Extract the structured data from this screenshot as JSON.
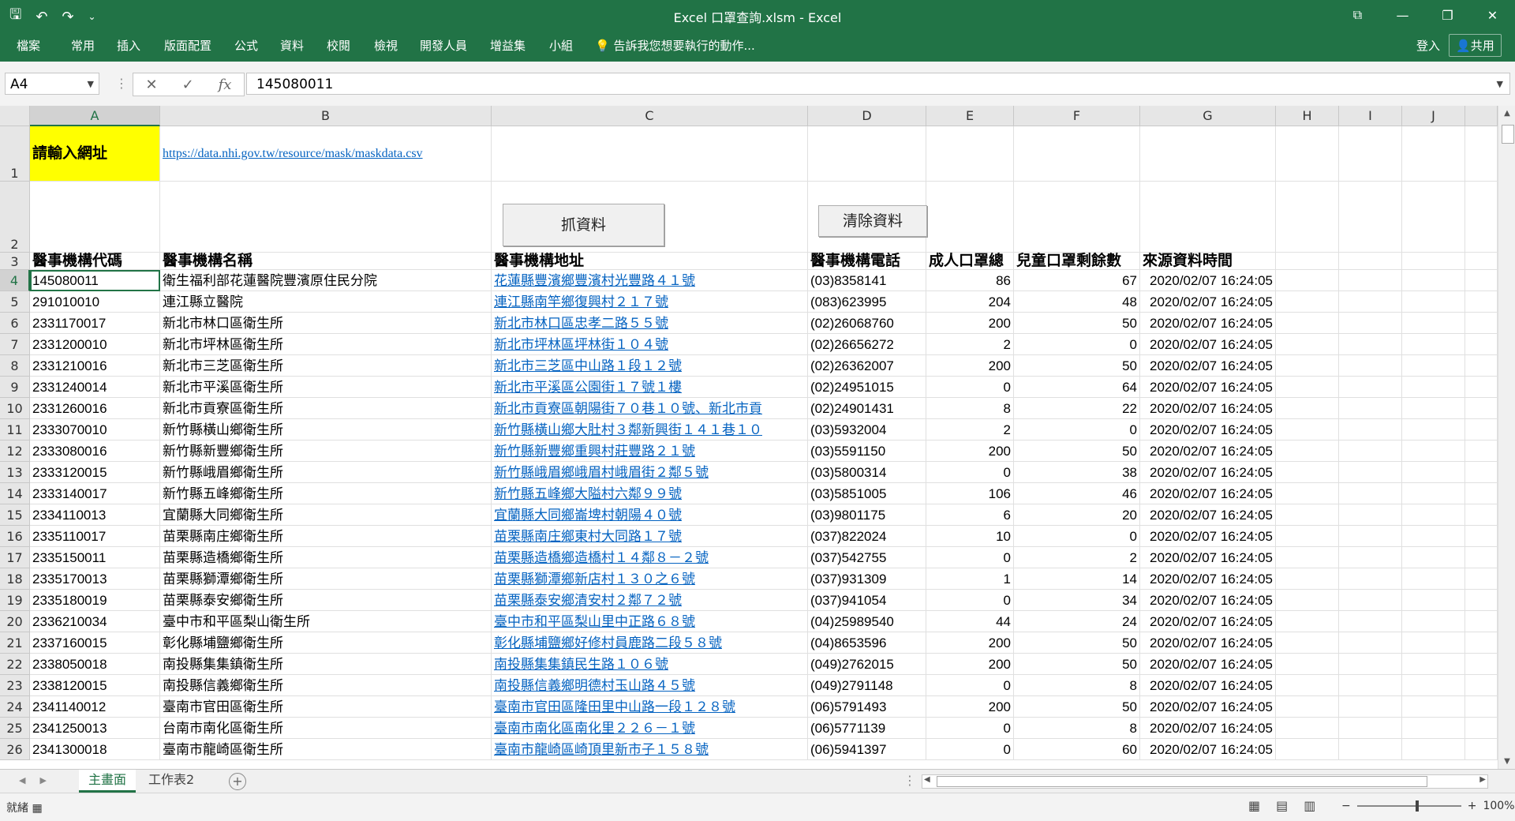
{
  "window": {
    "title": "Excel 口罩查詢.xlsm - Excel",
    "controls": [
      "⧉",
      "—",
      "❐",
      "✕"
    ]
  },
  "qat": {
    "save": "🖫",
    "undo": "↶",
    "redo": "↷",
    "more": "⌄"
  },
  "ribbon": {
    "tabs": [
      "檔案",
      "常用",
      "插入",
      "版面配置",
      "公式",
      "資料",
      "校閱",
      "檢視",
      "開發人員",
      "增益集",
      "小組"
    ],
    "tell_me": "告訴我您想要執行的動作...",
    "sign_in": "登入",
    "share": "共用"
  },
  "formula_bar": {
    "name_box": "A4",
    "cancel": "✕",
    "enter": "✓",
    "fx": "fx",
    "value": "145080011"
  },
  "columns": [
    "A",
    "B",
    "C",
    "D",
    "E",
    "F",
    "G",
    "H",
    "I",
    "J"
  ],
  "row1": {
    "label": "請輸入網址",
    "url": "https://data.nhi.gov.tw/resource/mask/maskdata.csv"
  },
  "buttons": {
    "fetch": "抓資料",
    "clear": "清除資料"
  },
  "headers": [
    "醫事機構代碼",
    "醫事機構名稱",
    "醫事機構地址",
    "醫事機構電話",
    "成人口罩總",
    "兒童口罩剩餘數",
    "來源資料時間"
  ],
  "rows": [
    {
      "code": "145080011",
      "name": "衛生福利部花蓮醫院豐濱原住民分院",
      "addr": "花蓮縣豐濱鄉豐濱村光豐路４１號",
      "tel": "(03)8358141",
      "adult": "86",
      "child": "67",
      "time": "2020/02/07 16:24:05"
    },
    {
      "code": "291010010",
      "name": "連江縣立醫院",
      "addr": "連江縣南竿鄉復興村２１７號",
      "tel": "(083)623995",
      "adult": "204",
      "child": "48",
      "time": "2020/02/07 16:24:05"
    },
    {
      "code": "2331170017",
      "name": "新北市林口區衛生所",
      "addr": "新北市林口區忠孝二路５５號",
      "tel": "(02)26068760",
      "adult": "200",
      "child": "50",
      "time": "2020/02/07 16:24:05"
    },
    {
      "code": "2331200010",
      "name": "新北市坪林區衛生所",
      "addr": "新北市坪林區坪林街１０４號",
      "tel": "(02)26656272",
      "adult": "2",
      "child": "0",
      "time": "2020/02/07 16:24:05"
    },
    {
      "code": "2331210016",
      "name": "新北市三芝區衛生所",
      "addr": "新北市三芝區中山路１段１２號",
      "tel": "(02)26362007",
      "adult": "200",
      "child": "50",
      "time": "2020/02/07 16:24:05"
    },
    {
      "code": "2331240014",
      "name": "新北市平溪區衛生所",
      "addr": "新北市平溪區公園街１７號１樓",
      "tel": "(02)24951015",
      "adult": "0",
      "child": "64",
      "time": "2020/02/07 16:24:05"
    },
    {
      "code": "2331260016",
      "name": "新北市貢寮區衛生所",
      "addr": "新北市貢寮區朝陽街７０巷１０號、新北市貢",
      "tel": "(02)24901431",
      "adult": "8",
      "child": "22",
      "time": "2020/02/07 16:24:05"
    },
    {
      "code": "2333070010",
      "name": "新竹縣橫山鄉衛生所",
      "addr": "新竹縣橫山鄉大肚村３鄰新興街１４１巷１０",
      "tel": "(03)5932004",
      "adult": "2",
      "child": "0",
      "time": "2020/02/07 16:24:05"
    },
    {
      "code": "2333080016",
      "name": "新竹縣新豐鄉衛生所",
      "addr": "新竹縣新豐鄉重興村莊豐路２１號",
      "tel": "(03)5591150",
      "adult": "200",
      "child": "50",
      "time": "2020/02/07 16:24:05"
    },
    {
      "code": "2333120015",
      "name": "新竹縣峨眉鄉衛生所",
      "addr": "新竹縣峨眉鄉峨眉村峨眉街２鄰５號",
      "tel": "(03)5800314",
      "adult": "0",
      "child": "38",
      "time": "2020/02/07 16:24:05"
    },
    {
      "code": "2333140017",
      "name": "新竹縣五峰鄉衛生所",
      "addr": "新竹縣五峰鄉大隘村六鄰９９號",
      "tel": "(03)5851005",
      "adult": "106",
      "child": "46",
      "time": "2020/02/07 16:24:05"
    },
    {
      "code": "2334110013",
      "name": "宜蘭縣大同鄉衛生所",
      "addr": "宜蘭縣大同鄉崙埤村朝陽４０號",
      "tel": "(03)9801175",
      "adult": "6",
      "child": "20",
      "time": "2020/02/07 16:24:05"
    },
    {
      "code": "2335110017",
      "name": "苗栗縣南庄鄉衛生所",
      "addr": "苗栗縣南庄鄉東村大同路１７號",
      "tel": "(037)822024",
      "adult": "10",
      "child": "0",
      "time": "2020/02/07 16:24:05"
    },
    {
      "code": "2335150011",
      "name": "苗栗縣造橋鄉衛生所",
      "addr": "苗栗縣造橋鄉造橋村１４鄰８－２號",
      "tel": "(037)542755",
      "adult": "0",
      "child": "2",
      "time": "2020/02/07 16:24:05"
    },
    {
      "code": "2335170013",
      "name": "苗栗縣獅潭鄉衛生所",
      "addr": "苗栗縣獅潭鄉新店村１３０之６號",
      "tel": "(037)931309",
      "adult": "1",
      "child": "14",
      "time": "2020/02/07 16:24:05"
    },
    {
      "code": "2335180019",
      "name": "苗栗縣泰安鄉衛生所",
      "addr": "苗栗縣泰安鄉清安村２鄰７２號",
      "tel": "(037)941054",
      "adult": "0",
      "child": "34",
      "time": "2020/02/07 16:24:05"
    },
    {
      "code": "2336210034",
      "name": "臺中市和平區梨山衛生所",
      "addr": "臺中市和平區梨山里中正路６８號",
      "tel": "(04)25989540",
      "adult": "44",
      "child": "24",
      "time": "2020/02/07 16:24:05"
    },
    {
      "code": "2337160015",
      "name": "彰化縣埔鹽鄉衛生所",
      "addr": "彰化縣埔鹽鄉好修村員鹿路二段５８號",
      "tel": "(04)8653596",
      "adult": "200",
      "child": "50",
      "time": "2020/02/07 16:24:05"
    },
    {
      "code": "2338050018",
      "name": "南投縣集集鎮衛生所",
      "addr": "南投縣集集鎮民生路１０６號",
      "tel": "(049)2762015",
      "adult": "200",
      "child": "50",
      "time": "2020/02/07 16:24:05"
    },
    {
      "code": "2338120015",
      "name": "南投縣信義鄉衛生所",
      "addr": "南投縣信義鄉明德村玉山路４５號",
      "tel": "(049)2791148",
      "adult": "0",
      "child": "8",
      "time": "2020/02/07 16:24:05"
    },
    {
      "code": "2341140012",
      "name": "臺南市官田區衛生所",
      "addr": "臺南市官田區隆田里中山路一段１２８號",
      "tel": "(06)5791493",
      "adult": "200",
      "child": "50",
      "time": "2020/02/07 16:24:05"
    },
    {
      "code": "2341250013",
      "name": "台南市南化區衛生所",
      "addr": "臺南市南化區南化里２２６－１號",
      "tel": "(06)5771139",
      "adult": "0",
      "child": "8",
      "time": "2020/02/07 16:24:05"
    },
    {
      "code": "2341300018",
      "name": "臺南市龍崎區衛生所",
      "addr": "臺南市龍崎區崎頂里新市子１５８號",
      "tel": "(06)5941397",
      "adult": "0",
      "child": "60",
      "time": "2020/02/07 16:24:05"
    }
  ],
  "sheet_tabs": [
    "主畫面",
    "工作表2"
  ],
  "status": {
    "ready": "就緒",
    "zoom": "100%",
    "zoom_minus": "−",
    "zoom_plus": "+"
  },
  "colors": {
    "excel_green": "#217346",
    "link": "#0563c1",
    "highlight": "#ffff00"
  }
}
